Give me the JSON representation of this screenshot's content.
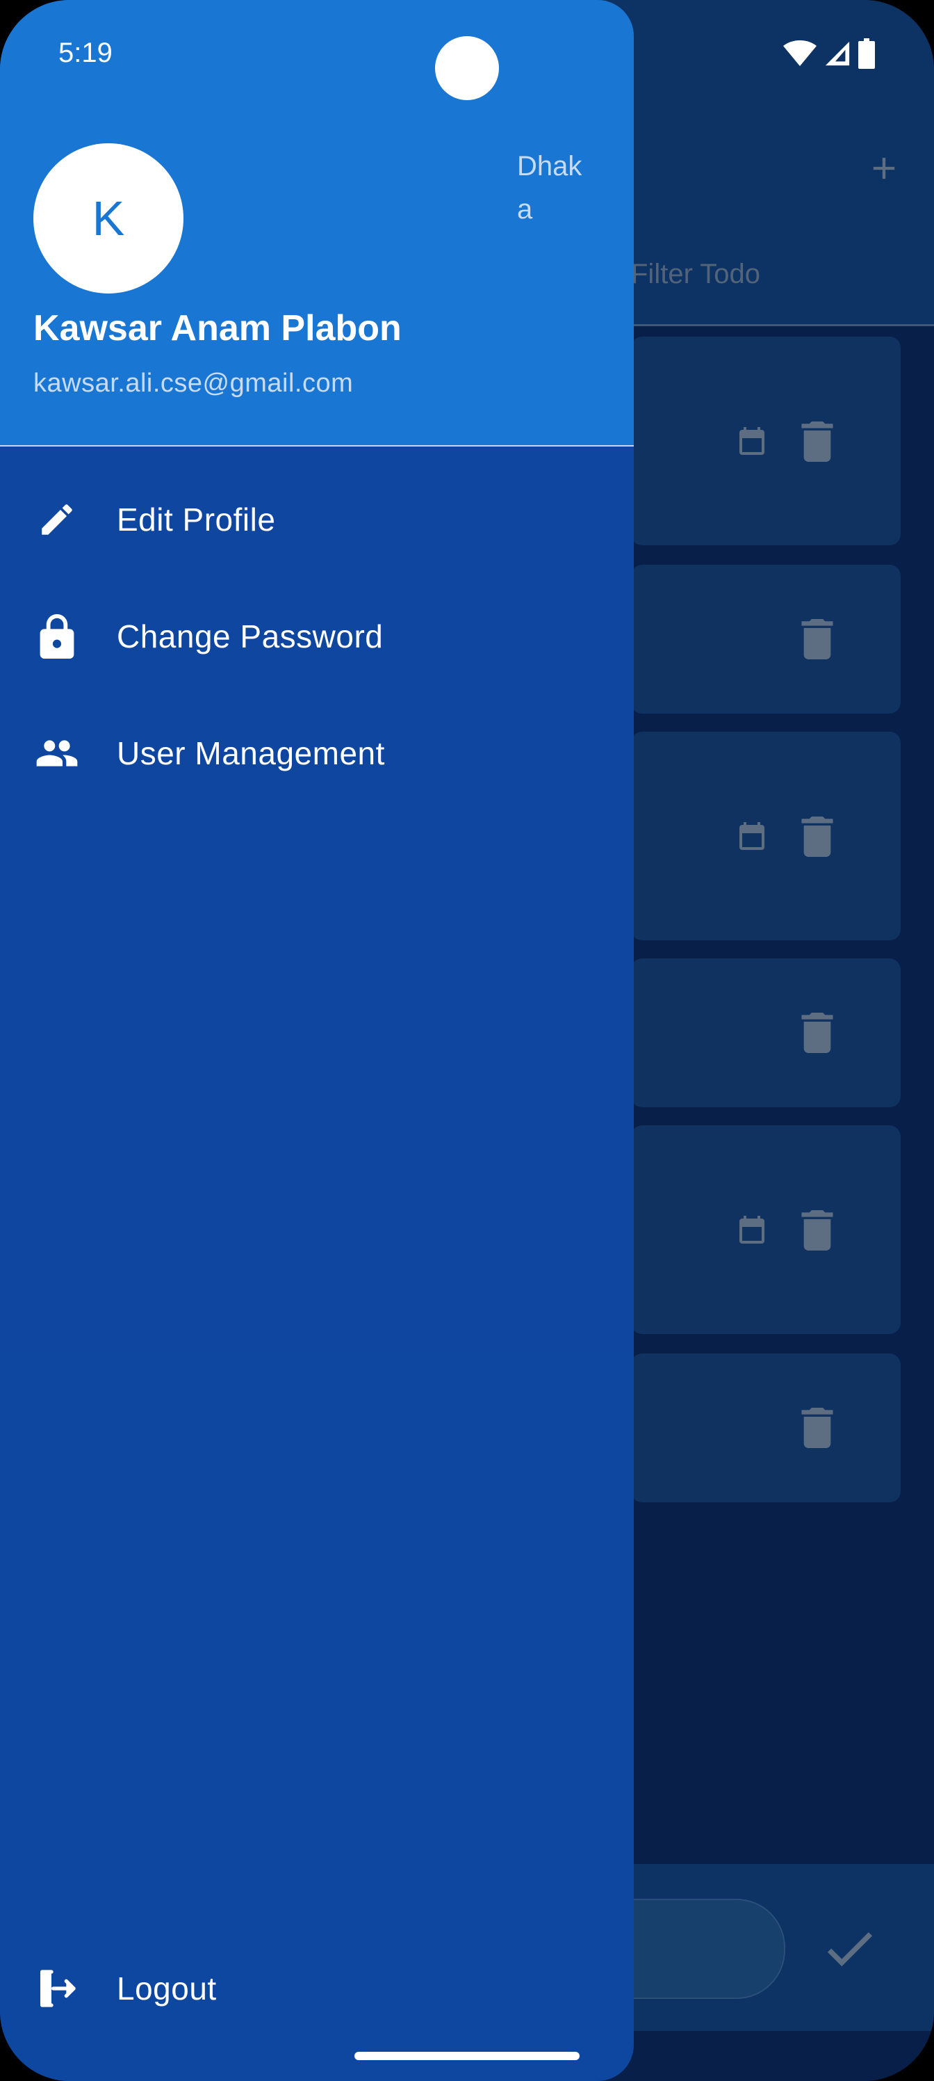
{
  "status_bar": {
    "time": "5:19"
  },
  "background_app": {
    "filter_tab_label": "Filter Todo",
    "add_icon": "plus-icon",
    "card_icons": [
      "calendar-icon",
      "delete-icon"
    ],
    "confirm_icon": "check-icon"
  },
  "drawer": {
    "avatar_initial": "K",
    "location": "Dhaka",
    "user_name": "Kawsar Anam Plabon",
    "user_email": "kawsar.ali.cse@gmail.com",
    "menu": [
      {
        "label": "Edit Profile",
        "icon": "pencil-icon"
      },
      {
        "label": "Change Password",
        "icon": "lock-icon"
      },
      {
        "label": "User Management",
        "icon": "people-icon"
      }
    ],
    "logout_label": "Logout",
    "logout_icon": "logout-icon"
  },
  "colors": {
    "drawer_header": "#1976d2",
    "drawer_body": "#0e47a0",
    "scrim_app_bar": "#0d3364",
    "scrim_body": "#081f4a"
  }
}
